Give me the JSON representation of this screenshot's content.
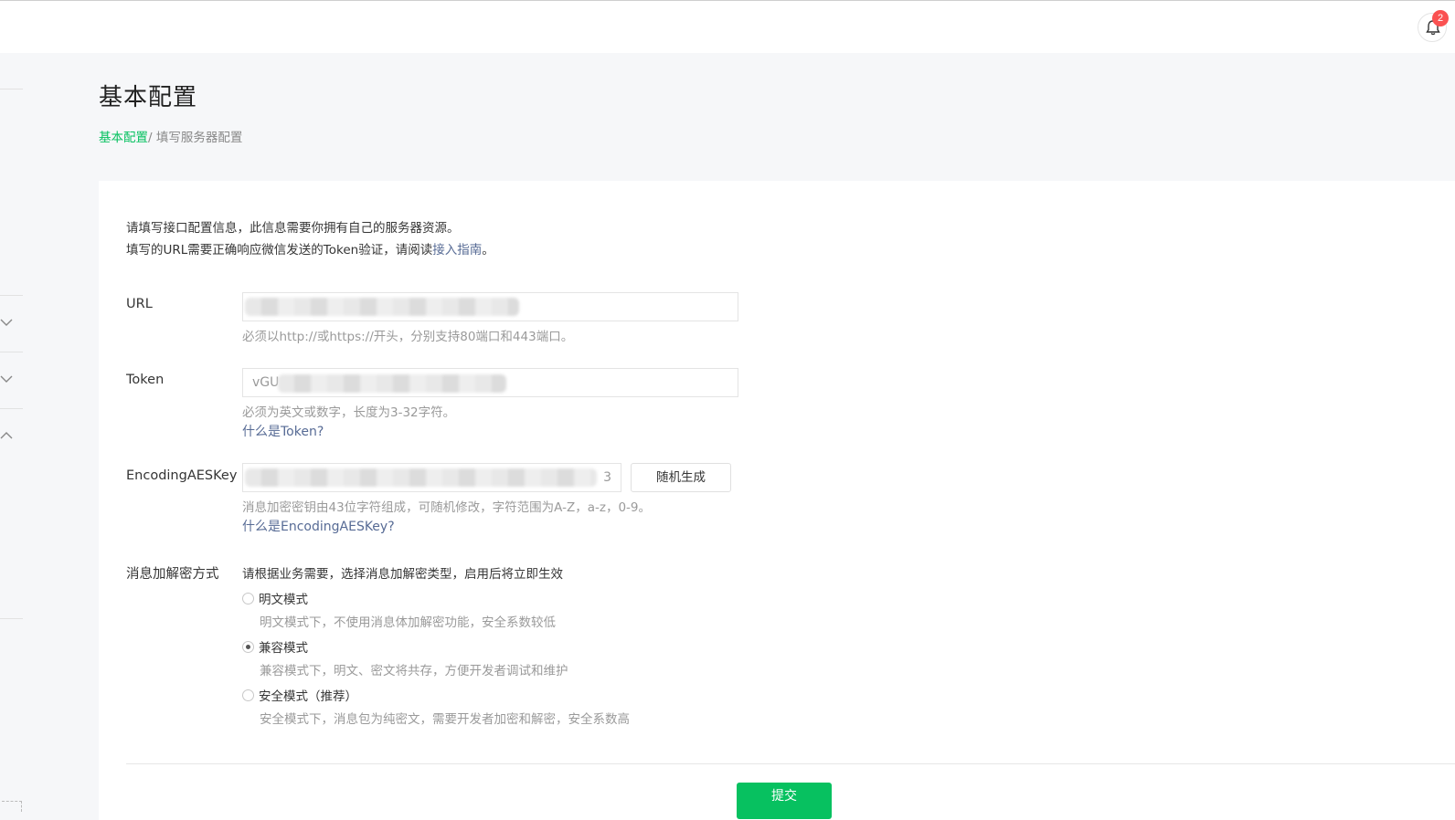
{
  "header": {
    "notification_count": "2",
    "accent_color": "#07c160",
    "icon": "bell-icon"
  },
  "page": {
    "title": "基本配置",
    "breadcrumb": {
      "root": "基本配置",
      "separator": "/ ",
      "current": "填写服务器配置"
    }
  },
  "intro": {
    "line1": "请填写接口配置信息，此信息需要你拥有自己的服务器资源。",
    "line2_prefix": "填写的URL需要正确响应微信发送的Token验证，请阅读",
    "line2_link": "接入指南",
    "line2_suffix": "。"
  },
  "form": {
    "url": {
      "label": "URL",
      "hint": "必须以http://或https://开头，分别支持80端口和443端口。"
    },
    "token": {
      "label": "Token",
      "value_visible": "vGU",
      "hint": "必须为英文或数字，长度为3-32字符。",
      "help_link": "什么是Token?"
    },
    "aes_key": {
      "label": "EncodingAESKey",
      "value_visible": "3",
      "random_button": "随机生成",
      "hint": "消息加密密钥由43位字符组成，可随机修改，字符范围为A-Z，a-z，0-9。",
      "help_link": "什么是EncodingAESKey?"
    },
    "encryption": {
      "label": "消息加解密方式",
      "description": "请根据业务需要，选择消息加解密类型，启用后将立即生效",
      "options": [
        {
          "label": "明文模式",
          "desc": "明文模式下，不使用消息体加解密功能，安全系数较低",
          "checked": false
        },
        {
          "label": "兼容模式",
          "desc": "兼容模式下，明文、密文将共存，方便开发者调试和维护",
          "checked": true
        },
        {
          "label": "安全模式（推荐）",
          "desc": "安全模式下，消息包为纯密文，需要开发者加密和解密，安全系数高",
          "checked": false
        }
      ]
    },
    "submit": "提交"
  }
}
